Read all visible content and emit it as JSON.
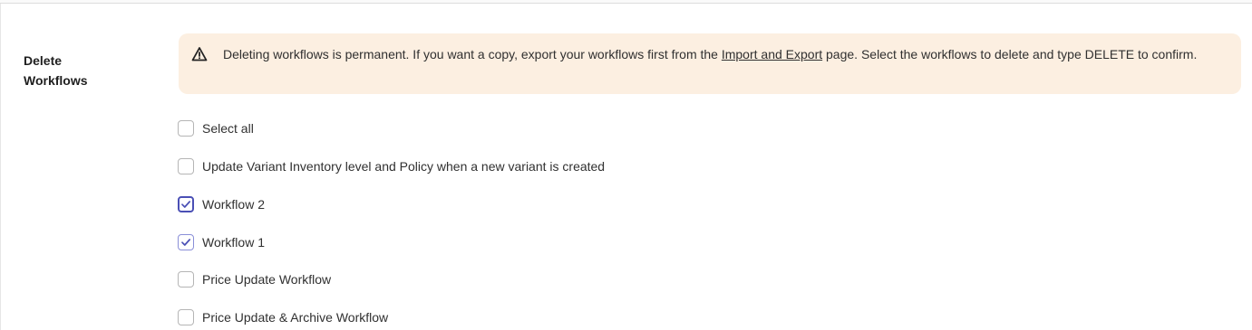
{
  "section": {
    "title_line1": "Delete",
    "title_line2": "Workflows"
  },
  "banner": {
    "icon": "warning-triangle-icon",
    "text_before": "Deleting workflows is permanent. If you want a copy, export your workflows first from the ",
    "link_text": "Import and Export",
    "text_after": " page. Select the workflows to delete and type DELETE to confirm.",
    "background_color": "#fcefe1"
  },
  "options": [
    {
      "label": "Select all",
      "checked": false
    },
    {
      "label": "Update Variant Inventory level and Policy when a new variant is created",
      "checked": false
    },
    {
      "label": "Workflow 2",
      "checked": true,
      "focused": true
    },
    {
      "label": "Workflow 1",
      "checked": true
    },
    {
      "label": "Price Update Workflow",
      "checked": false
    },
    {
      "label": "Price Update & Archive Workflow",
      "checked": false
    }
  ],
  "colors": {
    "checkmark": "#4a4fb5"
  }
}
